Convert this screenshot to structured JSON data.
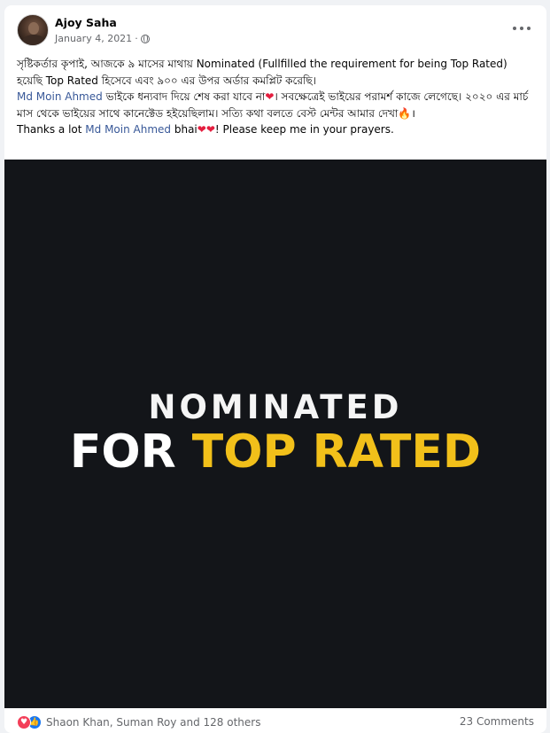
{
  "post": {
    "author": "Ajoy Saha",
    "date": "January 4, 2021",
    "separator": "·",
    "visibility_icon": "globe-icon",
    "more_icon": "more-horizontal-icon",
    "text": {
      "p1": "সৃষ্টিকর্তার কৃপাই, আজকে ৯ মাসের মাথায় Nominated (Fullfilled the requirement for being Top Rated) হয়েছি Top Rated হিসেবে এবং ৯০০ এর উপর অর্ডার কমপ্লিট করেছি।",
      "p2_mention": "Md Moin Ahmed",
      "p2_after_mention": " ভাইকে ধন্যবাদ দিয়ে শেষ করা যাবে না",
      "p2_heart": "❤",
      "p2_rest": "। সবক্ষেত্রেই ভাইয়ের পরামর্শ কাজে লেগেছে। ২০২০ এর মার্চ মাস থেকে ভাইয়ের সাথে কানেক্টেড হইয়েছিলাম। সত্যি কথা বলতে বেস্ট মেন্টর আমার দেখা",
      "p2_fire": "🔥",
      "p2_end": "।",
      "p3_before": "Thanks a lot ",
      "p3_mention": "Md Moin Ahmed",
      "p3_after": " bhai",
      "p3_hearts": "❤❤",
      "p3_end": "! Please keep me in your prayers."
    },
    "image": {
      "line1": "NOMINATED",
      "line2_white": "FOR ",
      "line2_accent": "TOP RATED",
      "background": "#131519",
      "accent_color": "#f2c01a"
    },
    "footer": {
      "reaction_icons": [
        "love-icon",
        "like-icon"
      ],
      "reactions_text": "Shaon Khan, Suman Roy and 128 others",
      "comments": "23 Comments"
    }
  }
}
